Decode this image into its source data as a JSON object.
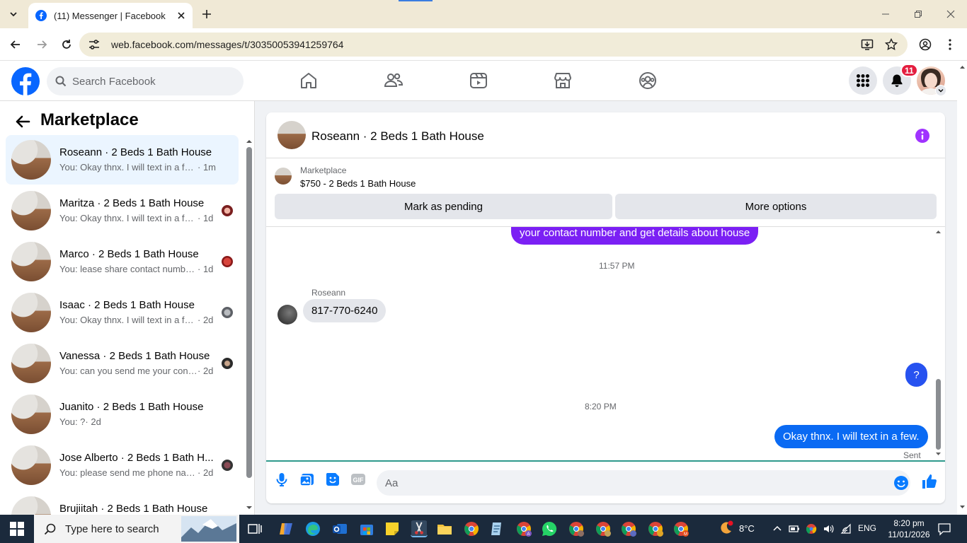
{
  "browser": {
    "tab_title": "(11) Messenger | Facebook",
    "url": "web.facebook.com/messages/t/30350053941259764"
  },
  "fb_header": {
    "search_placeholder": "Search Facebook",
    "notification_count": "11",
    "brand_color": "#0866ff"
  },
  "left_panel": {
    "title": "Marketplace",
    "conversations": [
      {
        "name": "Roseann · 2 Beds 1 Bath House",
        "preview": "You: Okay thnx. I will text in a few.",
        "time": "· 1m",
        "active": true
      },
      {
        "name": "Maritza · 2 Beds 1 Bath House",
        "preview": "You: Okay thnx. I will text in a few.",
        "time": "· 1d"
      },
      {
        "name": "Marco · 2 Beds 1 Bath House",
        "preview": "You: lease share contact number...",
        "time": "· 1d"
      },
      {
        "name": "Isaac · 2 Beds 1 Bath House",
        "preview": "You: Okay thnx. I will text in a few.",
        "time": "· 2d"
      },
      {
        "name": "Vanessa · 2 Beds 1 Bath House",
        "preview": "You: can you send me your cont...",
        "time": "· 2d"
      },
      {
        "name": "Juanito · 2 Beds 1 Bath House",
        "preview": "You: ?",
        "time": "· 2d"
      },
      {
        "name": "Jose Alberto · 2 Beds 1 Bath H...",
        "preview": "You: please send me phone nam...",
        "time": "· 2d"
      },
      {
        "name": "Brujiitah · 2 Beds 1 Bath House",
        "preview": "",
        "time": ""
      }
    ]
  },
  "chat": {
    "title": "Roseann · 2 Beds 1 Bath House",
    "listing_label": "Marketplace",
    "listing_price": "$750 - 2 Beds 1 Bath House",
    "mark_pending_label": "Mark as pending",
    "more_options_label": "More options",
    "messages": {
      "partial_out": "your  contact  number  and get details about house",
      "ts1": "11:57 PM",
      "sender": "Roseann",
      "incoming": "817-770-6240",
      "question": "?",
      "ts2": "8:20 PM",
      "last_out": "Okay thnx. I will text in a few.",
      "status": "Sent"
    },
    "input_placeholder": "Aa",
    "accent_color": "#7b20f4"
  },
  "taskbar": {
    "search_placeholder": "Type here to search",
    "weather": "8°C",
    "language": "ENG",
    "time": "8:20 pm",
    "date": "11/01/2026"
  }
}
